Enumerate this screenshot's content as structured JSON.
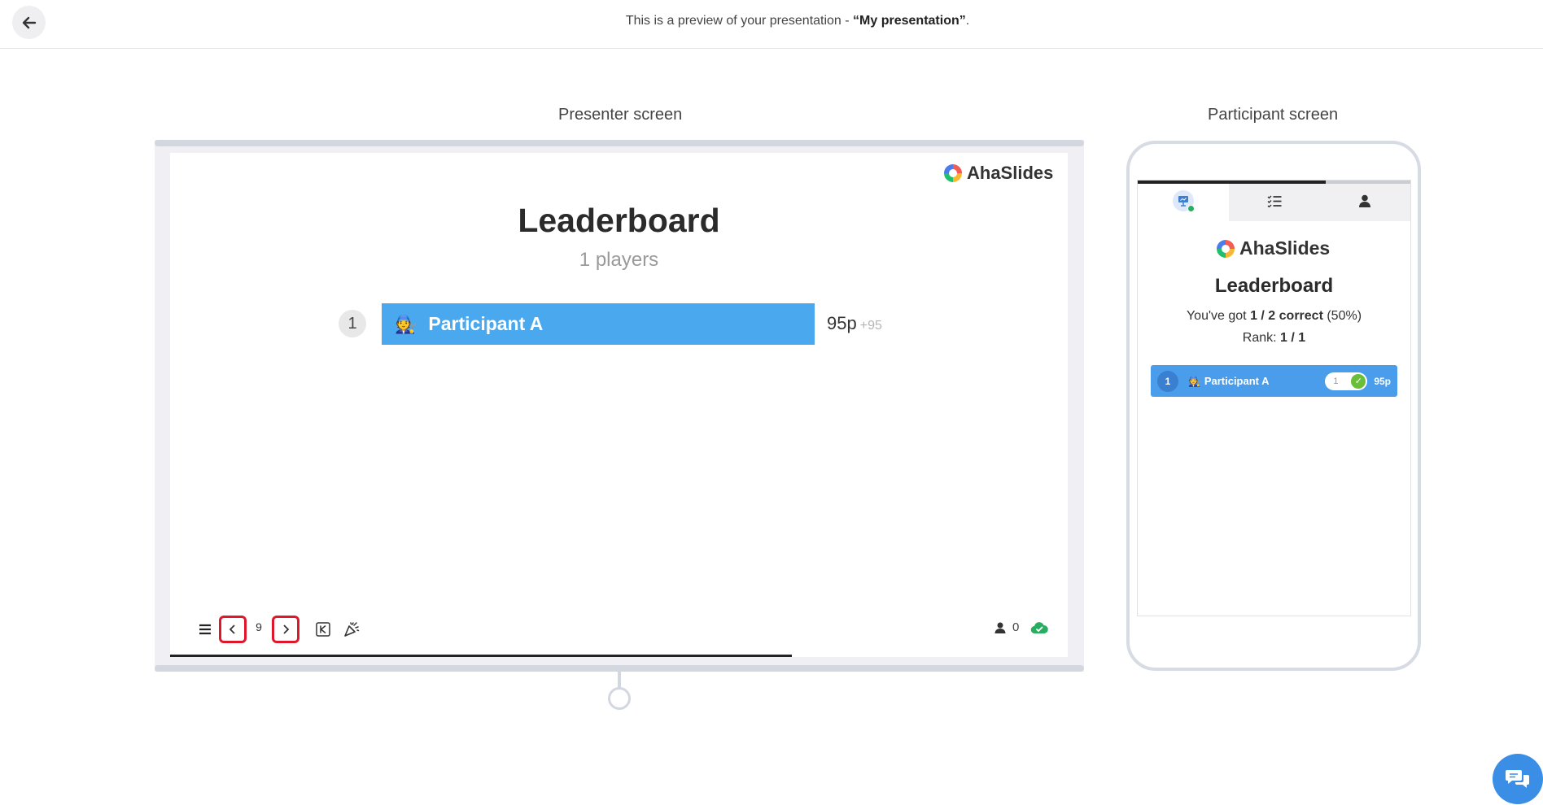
{
  "header": {
    "preview_prefix": "This is a preview of your presentation - ",
    "presentation_name": "“My presentation”",
    "preview_suffix": "."
  },
  "labels": {
    "presenter": "Presenter screen",
    "participant": "Participant screen"
  },
  "brand": {
    "name": "AhaSlides"
  },
  "presenter": {
    "title": "Leaderboard",
    "subtitle": "1 players",
    "entries": [
      {
        "rank": "1",
        "emoji": "🧑‍🔧",
        "name": "Participant A",
        "score": "95p",
        "delta": "+95"
      }
    ],
    "controls": {
      "page": "9",
      "participants_count": "0"
    }
  },
  "participant": {
    "title": "Leaderboard",
    "line1_prefix": "You've got ",
    "line1_bold": "1 / 2 correct",
    "line1_suffix": " (50%)",
    "line2_prefix": "Rank: ",
    "line2_bold": "1 / 1",
    "entry": {
      "rank": "1",
      "emoji": "🧑‍🔧",
      "name": "Participant A",
      "toggle_value": "1",
      "score": "95p"
    }
  },
  "colors": {
    "bar_blue": "#4aa8ee",
    "highlight_red": "#e0172b",
    "status_green": "#27ae60"
  }
}
